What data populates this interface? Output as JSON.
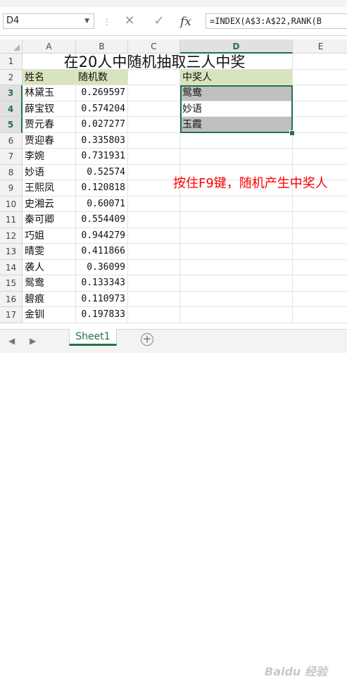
{
  "formula_bar": {
    "name_box": "D4",
    "fx": "fx",
    "formula": "=INDEX(A$3:A$22,RANK(B"
  },
  "columns": [
    "A",
    "B",
    "C",
    "D",
    "E"
  ],
  "selected_column": "D",
  "title": "在20人中随机抽取三人中奖",
  "headers": {
    "name": "姓名",
    "random": "随机数",
    "winner": "中奖人"
  },
  "rows": [
    {
      "num": "1"
    },
    {
      "num": "2"
    },
    {
      "num": "3",
      "name": "林黛玉",
      "value": "0.269597",
      "winner": "鸳鸯"
    },
    {
      "num": "4",
      "name": "薛宝钗",
      "value": "0.574204",
      "winner": "妙语"
    },
    {
      "num": "5",
      "name": "贾元春",
      "value": "0.027277",
      "winner": "玉霞"
    },
    {
      "num": "6",
      "name": "贾迎春",
      "value": "0.335803"
    },
    {
      "num": "7",
      "name": "李婉",
      "value": "0.731931"
    },
    {
      "num": "8",
      "name": "妙语",
      "value": "0.52574"
    },
    {
      "num": "9",
      "name": "王熙凤",
      "value": "0.120818"
    },
    {
      "num": "10",
      "name": "史湘云",
      "value": "0.60071"
    },
    {
      "num": "11",
      "name": "秦可卿",
      "value": "0.554409"
    },
    {
      "num": "12",
      "name": "巧姐",
      "value": "0.944279"
    },
    {
      "num": "13",
      "name": "晴雯",
      "value": "0.411866"
    },
    {
      "num": "14",
      "name": "袭人",
      "value": "0.36099"
    },
    {
      "num": "15",
      "name": "鸳鸯",
      "value": "0.133343"
    },
    {
      "num": "16",
      "name": "碧痕",
      "value": "0.110973"
    },
    {
      "num": "17",
      "name": "金钏",
      "value": "0.197833"
    }
  ],
  "note": "按住F9键，随机产生中奖人",
  "sheet_tab": "Sheet1",
  "watermark": "Baidu 经验",
  "colors": {
    "accent": "#217346",
    "note": "#ff0000",
    "header_fill": "#d8e4bc",
    "winner_fill": "#c0c0c0"
  }
}
